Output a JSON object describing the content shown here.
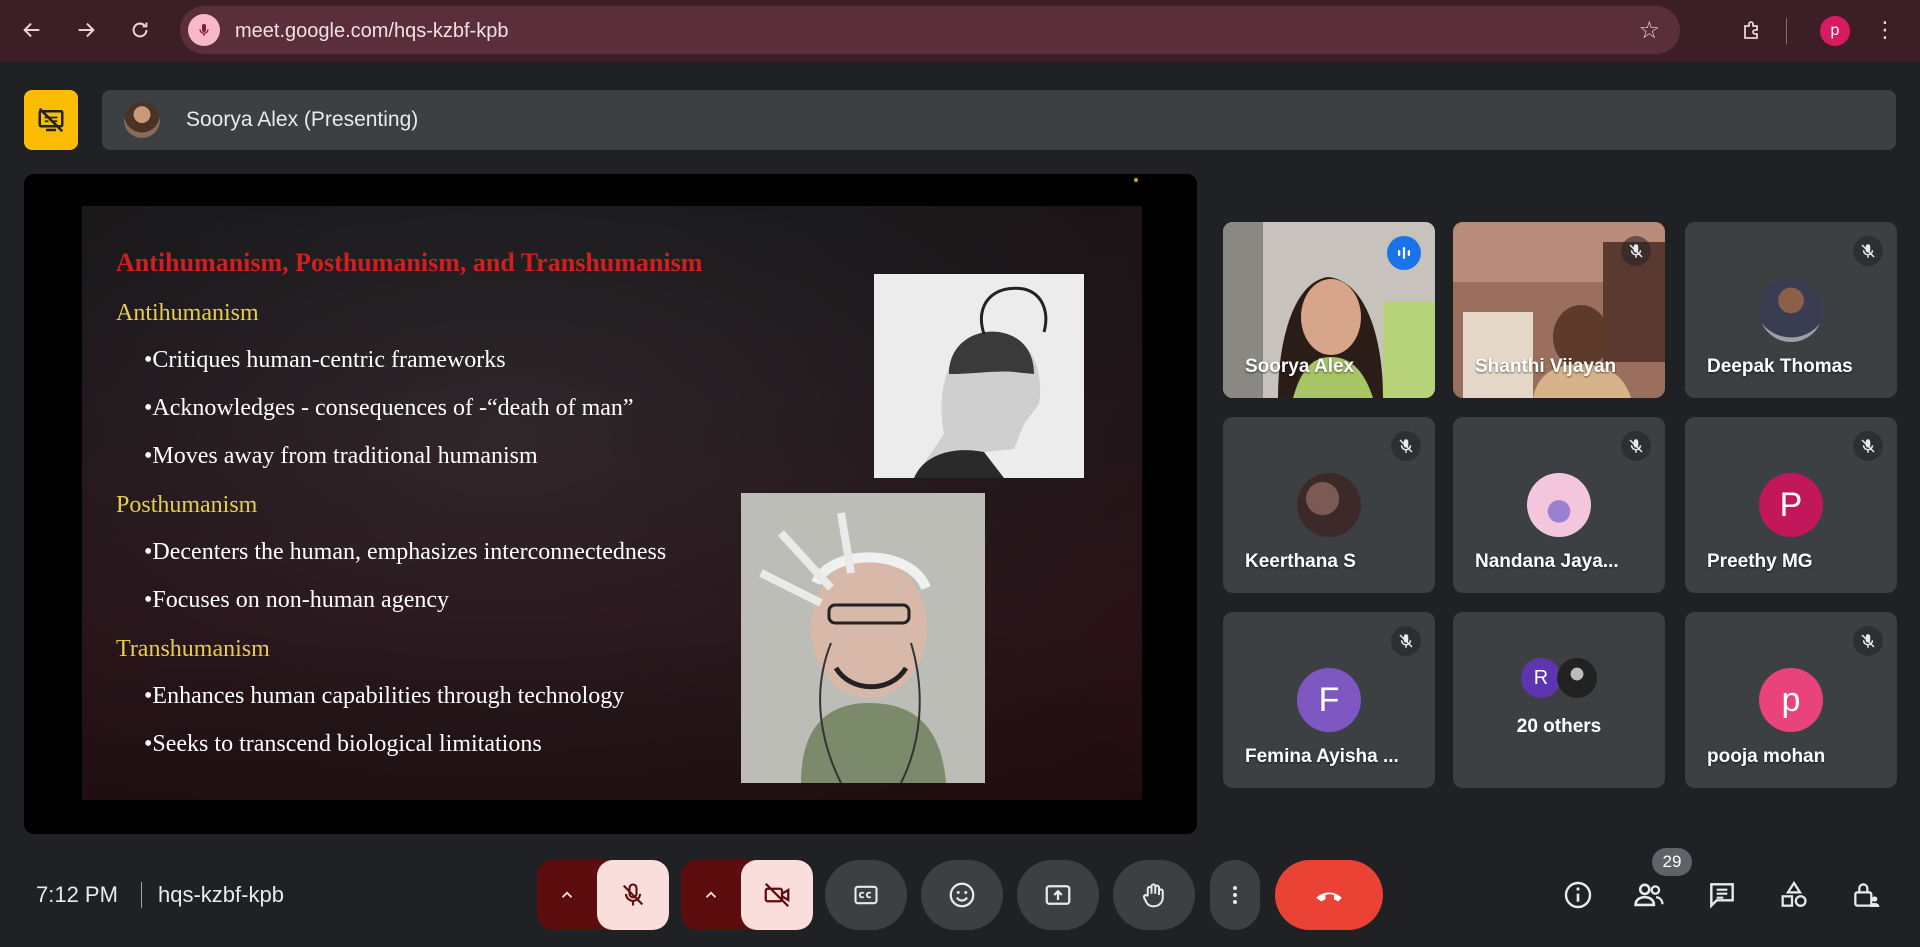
{
  "browser": {
    "url": "meet.google.com/hqs-kzbf-kpb",
    "profile_initial": "p"
  },
  "presenting": {
    "label": "Soorya Alex (Presenting)"
  },
  "slide": {
    "title": "Antihumanism, Posthumanism, and Transhumanism",
    "sections": [
      {
        "heading": "Antihumanism",
        "bullets": [
          "•Critiques human-centric frameworks",
          "•Acknowledges - consequences of -“death of man”",
          "•Moves away from traditional humanism"
        ]
      },
      {
        "heading": "Posthumanism",
        "bullets": [
          "•Decenters the human, emphasizes interconnectedness",
          "•Focuses on non-human agency"
        ]
      },
      {
        "heading": "Transhumanism",
        "bullets": [
          "•Enhances human capabilities through technology",
          "•Seeks to transcend biological limitations"
        ]
      }
    ]
  },
  "participants": [
    {
      "name": "Soorya Alex",
      "state": "speaking",
      "type": "video"
    },
    {
      "name": "Shanthi Vijayan",
      "state": "muted",
      "type": "video"
    },
    {
      "name": "Deepak Thomas",
      "state": "muted",
      "type": "photo"
    },
    {
      "name": "Keerthana S",
      "state": "muted",
      "type": "photo"
    },
    {
      "name": "Nandana Jaya...",
      "state": "muted",
      "type": "photo"
    },
    {
      "name": "Preethy MG",
      "state": "muted",
      "type": "initial",
      "initial": "P",
      "color": "#c2185b"
    },
    {
      "name": "Femina Ayisha ...",
      "state": "muted",
      "type": "initial",
      "initial": "F",
      "color": "#7e57c2"
    },
    {
      "name": "20 others",
      "type": "others",
      "initial": "R",
      "color": "#5e35b1"
    },
    {
      "name": "pooja mohan",
      "state": "muted",
      "type": "initial",
      "initial": "p",
      "color": "#e8437a"
    }
  ],
  "footer": {
    "time": "7:12 PM",
    "meeting_code": "hqs-kzbf-kpb",
    "people_count": "29"
  },
  "colors": {
    "end_call": "#ea4335",
    "mute_active": "#f9dedc",
    "present_stop": "#fbbc04",
    "speaking_ring": "#8ab4f8"
  }
}
